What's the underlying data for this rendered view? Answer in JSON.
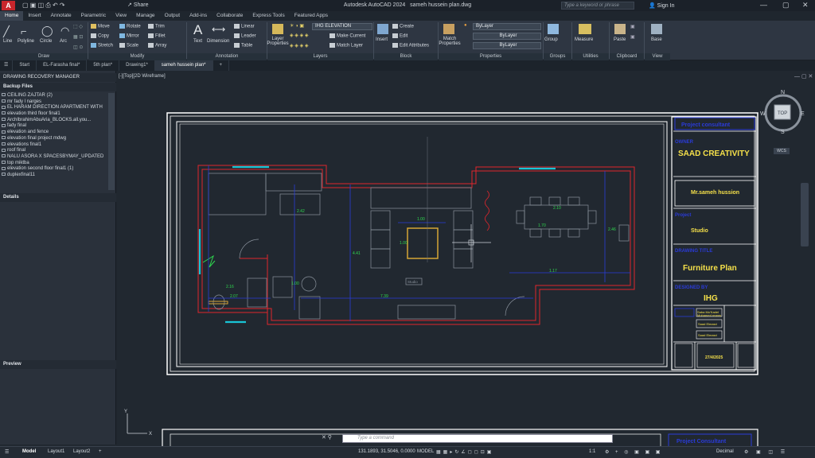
{
  "app": {
    "title": "Autodesk AutoCAD 2024",
    "file": "sameh hussein plan.dwg",
    "share": "Share",
    "search_placeholder": "Type a keyword or phrase",
    "signin": "Sign In"
  },
  "tabs": [
    "Home",
    "Insert",
    "Annotate",
    "Parametric",
    "View",
    "Manage",
    "Output",
    "Add-ins",
    "Collaborate",
    "Express Tools",
    "Featured Apps"
  ],
  "draw": {
    "line": "Line",
    "polyline": "Polyline",
    "circle": "Circle",
    "arc": "Arc",
    "group": "Draw"
  },
  "modify": {
    "move": "Move",
    "rotate": "Rotate",
    "trim": "Trim",
    "copy": "Copy",
    "mirror": "Mirror",
    "fillet": "Fillet",
    "stretch": "Stretch",
    "scale": "Scale",
    "array": "Array",
    "group": "Modify"
  },
  "annotation": {
    "text": "Text",
    "dimension": "Dimension",
    "linear": "Linear",
    "leader": "Leader",
    "table": "Table",
    "group": "Annotation"
  },
  "layers": {
    "props": "Layer Properties",
    "current": "IHG ELEVATION",
    "make_current": "Make Current",
    "match_layer": "Match Layer",
    "group": "Layers"
  },
  "block": {
    "insert": "Insert",
    "create": "Create",
    "edit": "Edit",
    "edit_attr": "Edit Attributes",
    "group": "Block"
  },
  "properties": {
    "match": "Match Properties",
    "bylayer1": "ByLayer",
    "bylayer2": "ByLayer",
    "bylayer3": "ByLayer",
    "group": "Properties"
  },
  "groups": {
    "label": "Group",
    "group": "Groups"
  },
  "utilities": {
    "measure": "Measure",
    "group": "Utilities"
  },
  "clipboard": {
    "paste": "Paste",
    "group": "Clipboard"
  },
  "view": {
    "base": "Base",
    "group": "View"
  },
  "filetabs": [
    "Start",
    "EL-Farasha final*",
    "5th plan*",
    "Drawing1*",
    "sameh hussein plan*"
  ],
  "left": {
    "manager": "DRAWING RECOVERY MANAGER",
    "backup": "Backup Files",
    "details": "Details",
    "preview": "Preview",
    "files": [
      "CEILING ZAJTAR (2)",
      "mr fady l narges",
      "EL HARAM DIRECTION APARTMENT WITH",
      "elevation third floor final1",
      "ArchIbrahimAbuAria_BLOCKS.all.you...",
      "fady final",
      "elevation and fence",
      "elevation final project mdwg",
      "elevations final1",
      "roof final",
      "NALU ASORA X SPACESBYMAY_UPDATED",
      "top miktba",
      "elevation second floor final1 (1)",
      "duplexfinal11"
    ]
  },
  "viewport": "[-][Top][2D Wireframe]",
  "cube": {
    "n": "N",
    "s": "S",
    "e": "E",
    "w": "W",
    "top": "TOP",
    "wcs": "WCS"
  },
  "titleblock": {
    "consultant": "Project consultant",
    "owner_label": "OWNER",
    "owner": "SAAD CREATIVITY",
    "person": "Mr.sameh hussion",
    "project_label": "Project",
    "project": "Studio",
    "drawing_label": "DRAWING TITLE",
    "drawing": "Furniture Plan",
    "designer_label": "DESIGNED BY",
    "designer": "IHG",
    "n1": "Saba Mo'Kadel",
    "n2": "Mohamed reams",
    "n3": "Saad Elmasri",
    "n4": "Saad Elmasri",
    "date": "27/4/2025",
    "consultant2": "Project Consultant"
  },
  "dims": {
    "d1": "1.00",
    "d2": "1.00",
    "d3": "2.10",
    "d4": "1.70",
    "d5": "2.46",
    "d6": "4.41",
    "d7": "2.42",
    "d8": "1.17",
    "d9": "2.16",
    "d10": "2.07",
    "d11": "1.00",
    "d12": "7.39",
    "d13": "Studio"
  },
  "cmd_placeholder": "Type a command",
  "status": {
    "model": "Model",
    "layout1": "Layout1",
    "layout2": "Layout2",
    "coords": "131.1893, 31.5046, 0.0000",
    "model_btn": "MODEL",
    "scale": "1:1",
    "units": "Decimal"
  }
}
